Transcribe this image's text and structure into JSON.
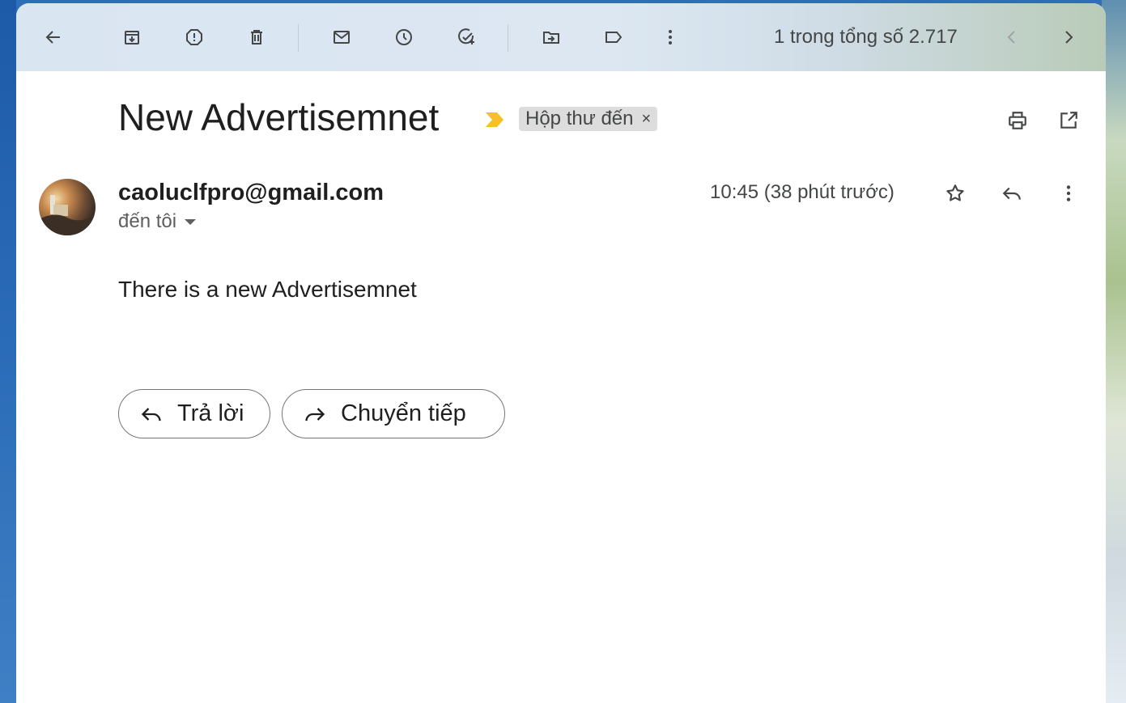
{
  "toolbar": {
    "back_icon": "arrow-left-icon",
    "archive_icon": "archive-icon",
    "report_icon": "report-spam-icon",
    "delete_icon": "trash-icon",
    "unread_icon": "mail-icon",
    "snooze_icon": "clock-icon",
    "add_task_icon": "add-task-icon",
    "move_icon": "move-to-icon",
    "label_icon": "label-icon",
    "more_icon": "more-vert-icon",
    "pager_text": "1 trong tổng số 2.717",
    "prev_icon": "chevron-left-icon",
    "next_icon": "chevron-right-icon"
  },
  "message": {
    "subject": "New Advertisemnet",
    "label": "Hộp thư đến",
    "label_close": "×",
    "sender": "caoluclfpro@gmail.com",
    "to": "đến tôi",
    "time": "10:45 (38 phút trước)",
    "body": "There is a new Advertisemnet"
  },
  "actions": {
    "reply": "Trả lời",
    "forward": "Chuyển tiếp"
  },
  "colors": {
    "importance": "#f6c026",
    "text_primary": "#1f1f1f",
    "text_secondary": "#444746",
    "chip_bg": "#dddddd"
  }
}
